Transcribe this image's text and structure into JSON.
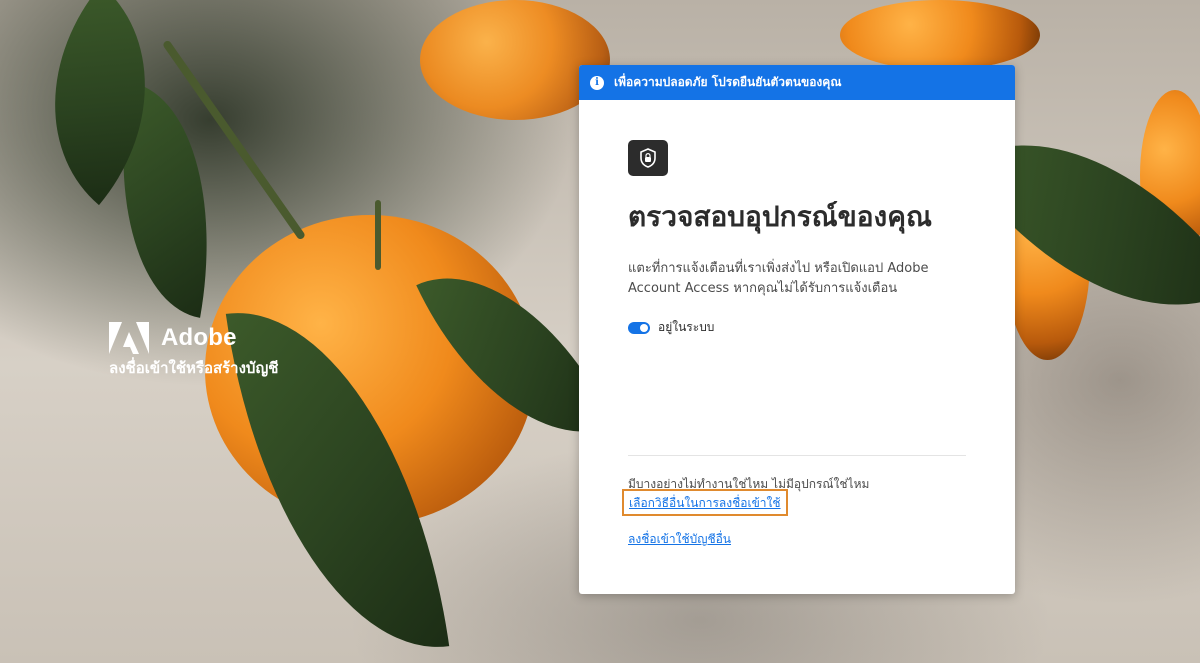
{
  "brand": {
    "name": "Adobe",
    "subtitle": "ลงชื่อเข้าใช้หรือสร้างบัญชี"
  },
  "banner": {
    "icon": "info-icon",
    "text": "เพื่อความปลอดภัย โปรดยืนยันตัวตนของคุณ"
  },
  "card": {
    "icon": "device-lock-icon",
    "title": "ตรวจสอบอุปกรณ์ของคุณ",
    "description": "แตะที่การแจ้งเตือนที่เราเพิ่งส่งไป หรือเปิดแอป Adobe Account Access หากคุณไม่ได้รับการแจ้งเตือน",
    "toggle_label": "อยู่ในระบบ",
    "toggle_on": true,
    "help_text": "มีบางอย่างไม่ทำงานใช่ไหม ไม่มีอุปกรณ์ใช่ไหม",
    "alt_signin_link": "เลือกวิธีอื่นในการลงชื่อเข้าใช้",
    "other_account_link": "ลงชื่อเข้าใช้บัญชีอื่น"
  },
  "colors": {
    "accent": "#1473e6",
    "highlight": "#e08a2e"
  }
}
